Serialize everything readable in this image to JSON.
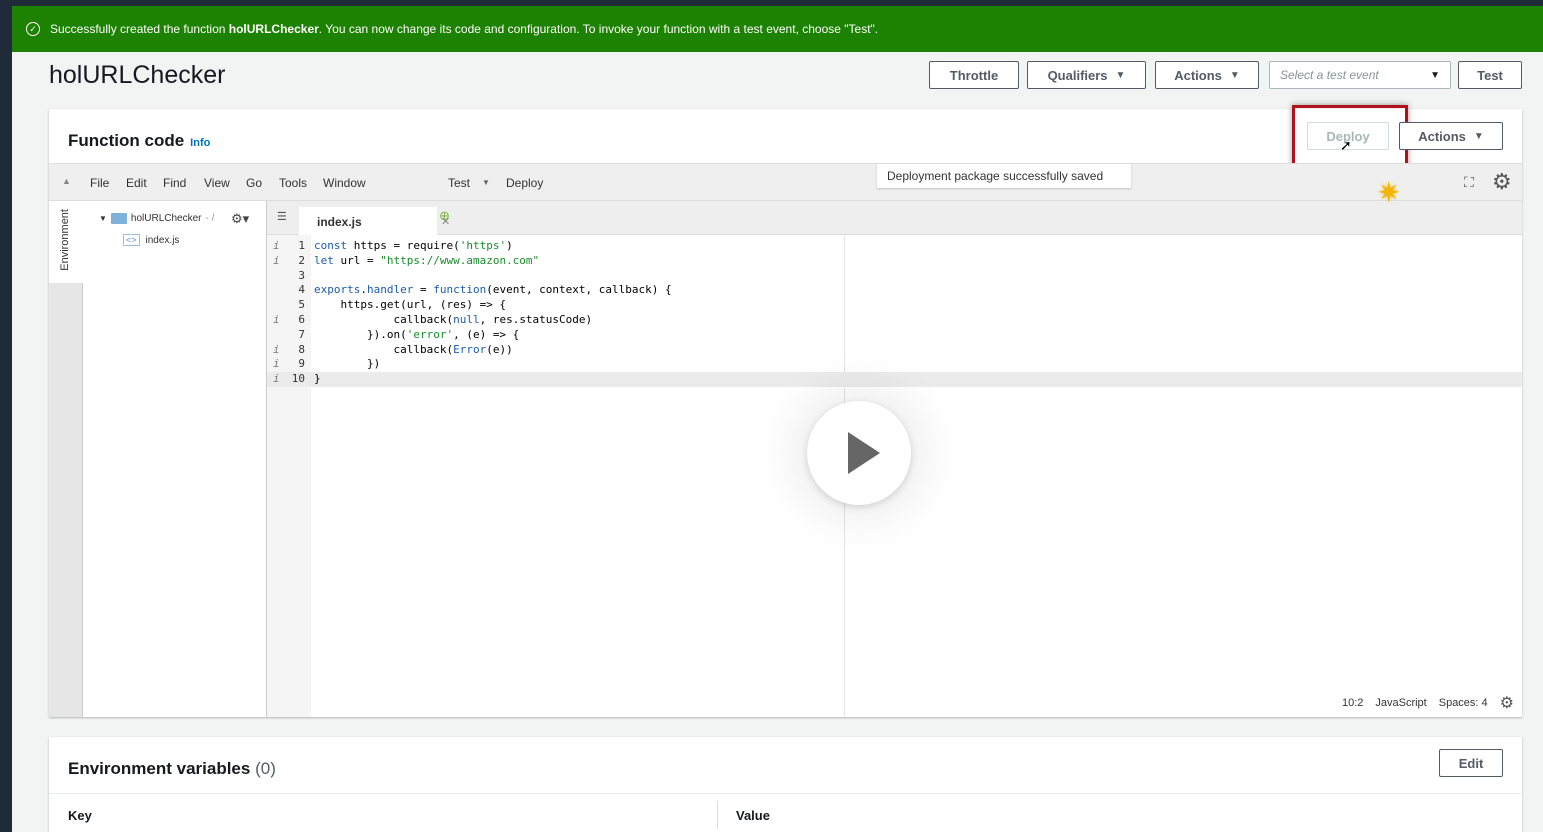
{
  "banner": {
    "text_before": "Successfully created the function ",
    "function_name": "holURLChecker",
    "text_after": ". You can now change its code and configuration. To invoke your function with a test event, choose \"Test\"."
  },
  "header": {
    "title": "holURLChecker",
    "throttle": "Throttle",
    "qualifiers": "Qualifiers",
    "actions": "Actions",
    "test_event_placeholder": "Select a test event",
    "test": "Test"
  },
  "function_code": {
    "title": "Function code",
    "info": "Info",
    "deploy": "Deploy",
    "actions": "Actions",
    "tooltip": "Deployment package successfully saved",
    "menu": [
      "File",
      "Edit",
      "Find",
      "View",
      "Go",
      "Tools",
      "Window"
    ],
    "test_menu": "Test",
    "deploy_menu": "Deploy",
    "env_tab": "Environment",
    "folder": "holURLChecker",
    "folder_path": "- /",
    "file": "index.js",
    "tab": "index.js",
    "code_lines": [
      {
        "n": "1",
        "marker": "i",
        "text": "const https = require('https')"
      },
      {
        "n": "2",
        "marker": "i",
        "text": "let url = \"https://www.amazon.com\""
      },
      {
        "n": "3",
        "marker": "",
        "text": ""
      },
      {
        "n": "4",
        "marker": "",
        "text": "exports.handler = function(event, context, callback) {"
      },
      {
        "n": "5",
        "marker": "",
        "text": "    https.get(url, (res) => {"
      },
      {
        "n": "6",
        "marker": "i",
        "text": "            callback(null, res.statusCode)"
      },
      {
        "n": "7",
        "marker": "",
        "text": "        }).on('error', (e) => {"
      },
      {
        "n": "8",
        "marker": "i",
        "text": "            callback(Error(e))"
      },
      {
        "n": "9",
        "marker": "i",
        "text": "        })"
      },
      {
        "n": "10",
        "marker": "i",
        "text": "}"
      }
    ],
    "status": {
      "position": "10:2",
      "language": "JavaScript",
      "spaces": "Spaces: 4"
    }
  },
  "env_vars": {
    "title": "Environment variables",
    "count": "(0)",
    "edit": "Edit",
    "col_key": "Key",
    "col_value": "Value"
  },
  "colors": {
    "banner": "#1d8102",
    "highlight": "#b0121d",
    "link": "#0073bb"
  }
}
